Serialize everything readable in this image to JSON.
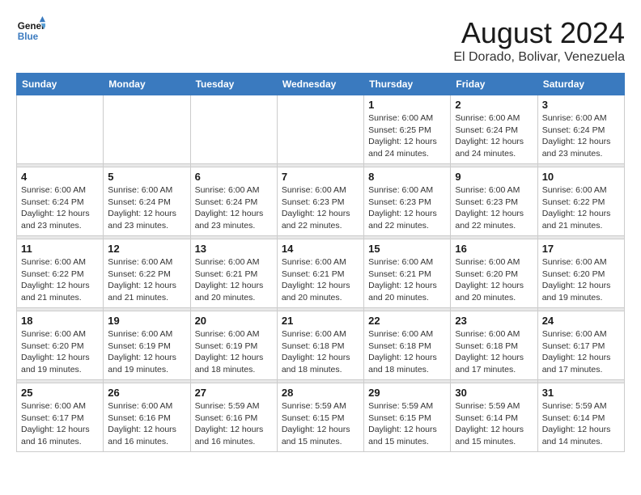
{
  "logo": {
    "line1": "General",
    "line2": "Blue"
  },
  "title": "August 2024",
  "location": "El Dorado, Bolivar, Venezuela",
  "headers": [
    "Sunday",
    "Monday",
    "Tuesday",
    "Wednesday",
    "Thursday",
    "Friday",
    "Saturday"
  ],
  "weeks": [
    [
      {
        "day": "",
        "info": ""
      },
      {
        "day": "",
        "info": ""
      },
      {
        "day": "",
        "info": ""
      },
      {
        "day": "",
        "info": ""
      },
      {
        "day": "1",
        "info": "Sunrise: 6:00 AM\nSunset: 6:25 PM\nDaylight: 12 hours\nand 24 minutes."
      },
      {
        "day": "2",
        "info": "Sunrise: 6:00 AM\nSunset: 6:24 PM\nDaylight: 12 hours\nand 24 minutes."
      },
      {
        "day": "3",
        "info": "Sunrise: 6:00 AM\nSunset: 6:24 PM\nDaylight: 12 hours\nand 23 minutes."
      }
    ],
    [
      {
        "day": "4",
        "info": "Sunrise: 6:00 AM\nSunset: 6:24 PM\nDaylight: 12 hours\nand 23 minutes."
      },
      {
        "day": "5",
        "info": "Sunrise: 6:00 AM\nSunset: 6:24 PM\nDaylight: 12 hours\nand 23 minutes."
      },
      {
        "day": "6",
        "info": "Sunrise: 6:00 AM\nSunset: 6:24 PM\nDaylight: 12 hours\nand 23 minutes."
      },
      {
        "day": "7",
        "info": "Sunrise: 6:00 AM\nSunset: 6:23 PM\nDaylight: 12 hours\nand 22 minutes."
      },
      {
        "day": "8",
        "info": "Sunrise: 6:00 AM\nSunset: 6:23 PM\nDaylight: 12 hours\nand 22 minutes."
      },
      {
        "day": "9",
        "info": "Sunrise: 6:00 AM\nSunset: 6:23 PM\nDaylight: 12 hours\nand 22 minutes."
      },
      {
        "day": "10",
        "info": "Sunrise: 6:00 AM\nSunset: 6:22 PM\nDaylight: 12 hours\nand 21 minutes."
      }
    ],
    [
      {
        "day": "11",
        "info": "Sunrise: 6:00 AM\nSunset: 6:22 PM\nDaylight: 12 hours\nand 21 minutes."
      },
      {
        "day": "12",
        "info": "Sunrise: 6:00 AM\nSunset: 6:22 PM\nDaylight: 12 hours\nand 21 minutes."
      },
      {
        "day": "13",
        "info": "Sunrise: 6:00 AM\nSunset: 6:21 PM\nDaylight: 12 hours\nand 20 minutes."
      },
      {
        "day": "14",
        "info": "Sunrise: 6:00 AM\nSunset: 6:21 PM\nDaylight: 12 hours\nand 20 minutes."
      },
      {
        "day": "15",
        "info": "Sunrise: 6:00 AM\nSunset: 6:21 PM\nDaylight: 12 hours\nand 20 minutes."
      },
      {
        "day": "16",
        "info": "Sunrise: 6:00 AM\nSunset: 6:20 PM\nDaylight: 12 hours\nand 20 minutes."
      },
      {
        "day": "17",
        "info": "Sunrise: 6:00 AM\nSunset: 6:20 PM\nDaylight: 12 hours\nand 19 minutes."
      }
    ],
    [
      {
        "day": "18",
        "info": "Sunrise: 6:00 AM\nSunset: 6:20 PM\nDaylight: 12 hours\nand 19 minutes."
      },
      {
        "day": "19",
        "info": "Sunrise: 6:00 AM\nSunset: 6:19 PM\nDaylight: 12 hours\nand 19 minutes."
      },
      {
        "day": "20",
        "info": "Sunrise: 6:00 AM\nSunset: 6:19 PM\nDaylight: 12 hours\nand 18 minutes."
      },
      {
        "day": "21",
        "info": "Sunrise: 6:00 AM\nSunset: 6:18 PM\nDaylight: 12 hours\nand 18 minutes."
      },
      {
        "day": "22",
        "info": "Sunrise: 6:00 AM\nSunset: 6:18 PM\nDaylight: 12 hours\nand 18 minutes."
      },
      {
        "day": "23",
        "info": "Sunrise: 6:00 AM\nSunset: 6:18 PM\nDaylight: 12 hours\nand 17 minutes."
      },
      {
        "day": "24",
        "info": "Sunrise: 6:00 AM\nSunset: 6:17 PM\nDaylight: 12 hours\nand 17 minutes."
      }
    ],
    [
      {
        "day": "25",
        "info": "Sunrise: 6:00 AM\nSunset: 6:17 PM\nDaylight: 12 hours\nand 16 minutes."
      },
      {
        "day": "26",
        "info": "Sunrise: 6:00 AM\nSunset: 6:16 PM\nDaylight: 12 hours\nand 16 minutes."
      },
      {
        "day": "27",
        "info": "Sunrise: 5:59 AM\nSunset: 6:16 PM\nDaylight: 12 hours\nand 16 minutes."
      },
      {
        "day": "28",
        "info": "Sunrise: 5:59 AM\nSunset: 6:15 PM\nDaylight: 12 hours\nand 15 minutes."
      },
      {
        "day": "29",
        "info": "Sunrise: 5:59 AM\nSunset: 6:15 PM\nDaylight: 12 hours\nand 15 minutes."
      },
      {
        "day": "30",
        "info": "Sunrise: 5:59 AM\nSunset: 6:14 PM\nDaylight: 12 hours\nand 15 minutes."
      },
      {
        "day": "31",
        "info": "Sunrise: 5:59 AM\nSunset: 6:14 PM\nDaylight: 12 hours\nand 14 minutes."
      }
    ]
  ]
}
